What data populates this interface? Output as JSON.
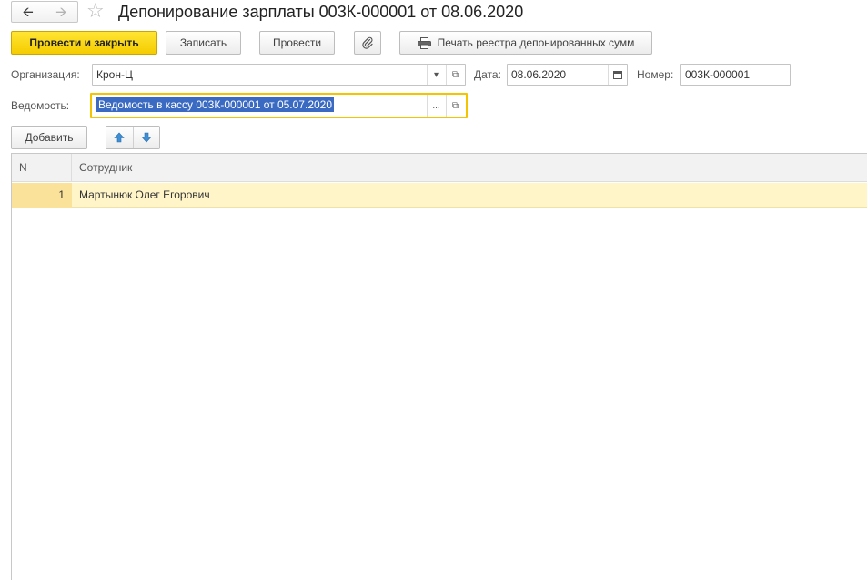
{
  "window": {
    "title": "Депонирование зарплаты 003К-000001 от 08.06.2020"
  },
  "toolbar": {
    "post_and_close_label": "Провести и закрыть",
    "save_label": "Записать",
    "post_label": "Провести",
    "print_label": "Печать реестра депонированных сумм"
  },
  "form": {
    "organization_label": "Организация:",
    "organization_value": "Крон-Ц",
    "date_label": "Дата:",
    "date_value": "08.06.2020",
    "number_label": "Номер:",
    "number_value": "003К-000001",
    "statement_label": "Ведомость:",
    "statement_value": "Ведомость в кассу 003К-000001 от 05.07.2020",
    "select_button_label": "..."
  },
  "table_toolbar": {
    "add_label": "Добавить"
  },
  "table": {
    "columns": [
      "N",
      "Сотрудник"
    ],
    "rows": [
      {
        "n": "1",
        "employee": "Мартынюк Олег Егорович"
      }
    ]
  },
  "colors": {
    "primary_button": "#f5cc00",
    "active_field_border": "#f4c400",
    "selected_text_bg": "#3a6ac1",
    "selected_row_bg": "#fff5c9",
    "arrow_icon": "#3d8fd6"
  }
}
